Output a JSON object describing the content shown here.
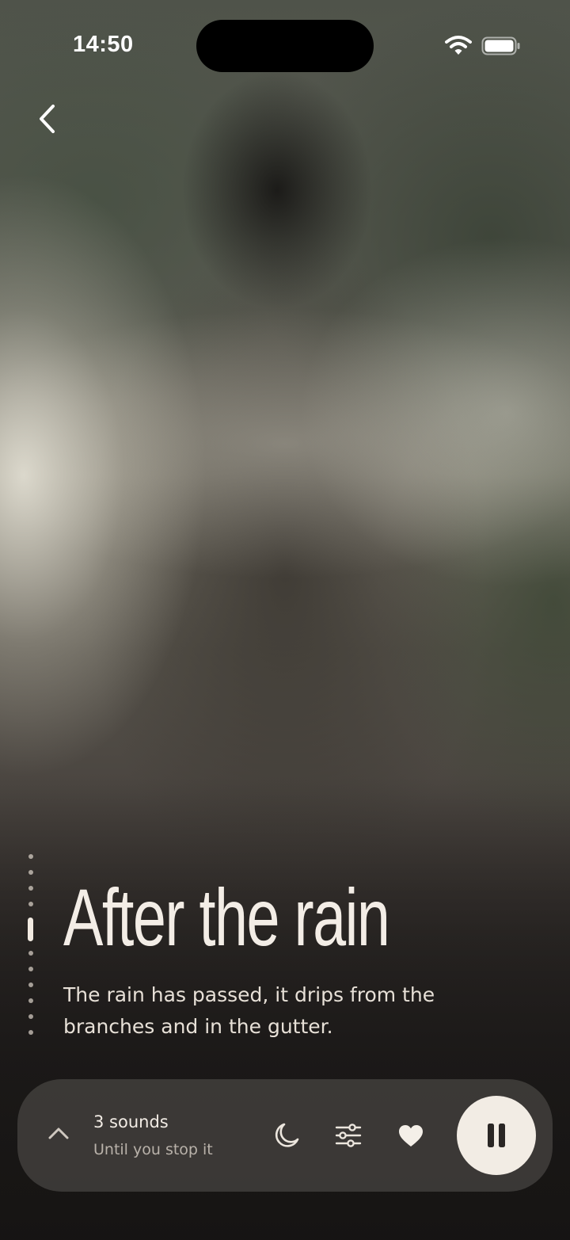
{
  "status_bar": {
    "time": "14:50",
    "icons": [
      "wifi-icon",
      "battery-icon"
    ]
  },
  "navigation": {
    "back_icon": "chevron-left-icon"
  },
  "pager": {
    "page_count": 11,
    "active_index": 4
  },
  "content": {
    "title": "After the rain",
    "description": "The rain has passed, it drips from the branches and in the gutter."
  },
  "player": {
    "expand_icon": "chevron-up-icon",
    "sounds_label": "3 sounds",
    "duration_label": "Until you stop it",
    "controls": [
      "moon-icon",
      "sliders-icon",
      "heart-icon",
      "pause-icon"
    ]
  },
  "colors": {
    "text_primary": "#f3ede6",
    "text_secondary": "#b9b2aa",
    "player_background": "#403d3b",
    "pause_button_background": "#f2ece4",
    "pause_icon": "#2a2624"
  }
}
